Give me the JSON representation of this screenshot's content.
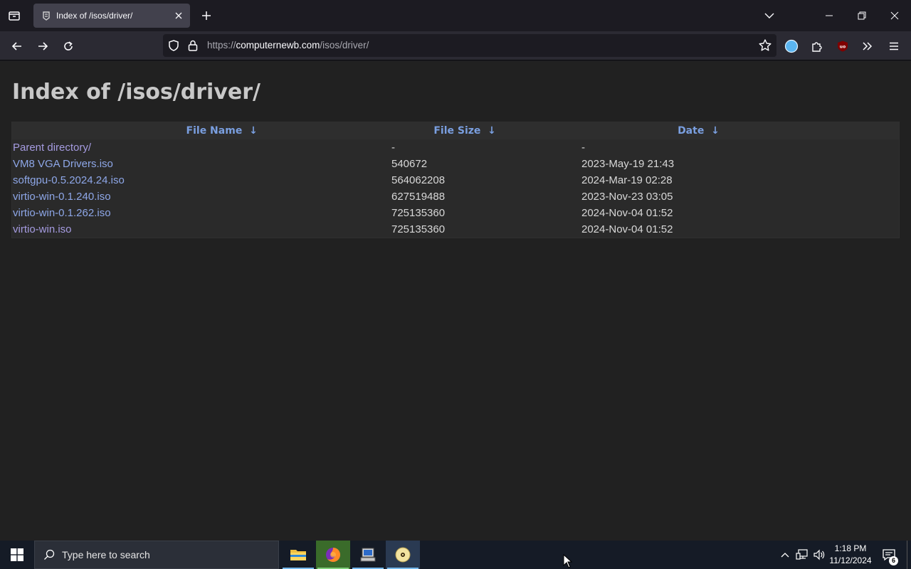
{
  "browser": {
    "tab": {
      "title": "Index of /isos/driver/"
    },
    "url": {
      "scheme": "https://",
      "host": "computernewb.com",
      "path": "/isos/driver/"
    }
  },
  "page": {
    "heading": "Index of /isos/driver/",
    "columns": [
      {
        "label": "File Name",
        "sort_arrow": "↓"
      },
      {
        "label": "File Size",
        "sort_arrow": "↓"
      },
      {
        "label": "Date",
        "sort_arrow": "↓"
      }
    ],
    "rows": [
      {
        "name": "Parent directory/",
        "size": "-",
        "date": "-"
      },
      {
        "name": "VM8 VGA Drivers.iso",
        "size": "540672",
        "date": "2023-May-19 21:43"
      },
      {
        "name": "softgpu-0.5.2024.24.iso",
        "size": "564062208",
        "date": "2024-Mar-19 02:28"
      },
      {
        "name": "virtio-win-0.1.240.iso",
        "size": "627519488",
        "date": "2023-Nov-23 03:05"
      },
      {
        "name": "virtio-win-0.1.262.iso",
        "size": "725135360",
        "date": "2024-Nov-04 01:52"
      },
      {
        "name": "virtio-win.iso",
        "size": "725135360",
        "date": "2024-Nov-04 01:52"
      }
    ]
  },
  "taskbar": {
    "search_placeholder": "Type here to search",
    "clock_time": "1:18 PM",
    "clock_date": "11/12/2024",
    "notification_count": "6"
  },
  "colors": {
    "link": "#8ea7e8",
    "visited": "#a59be0",
    "header_text": "#7a9fe0",
    "page_bg": "#212121"
  }
}
